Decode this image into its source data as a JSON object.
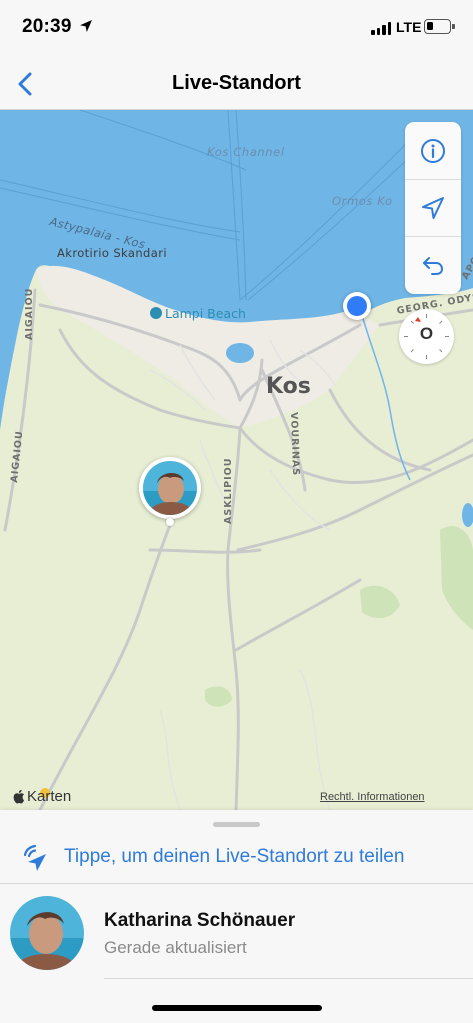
{
  "status_bar": {
    "time": "20:39",
    "network": "LTE",
    "location_icon": "location-arrow-icon",
    "battery_level_pct": 20
  },
  "nav": {
    "title": "Live-Standort",
    "back_icon": "chevron-left-icon"
  },
  "map": {
    "water_labels": [
      "Kos Channel",
      "Ormos Ko"
    ],
    "cape_labels": [
      "Astypalaia - Kos",
      "Akrotirio Skandari"
    ],
    "city_label": "Kos",
    "poi_label": "Lampi Beach",
    "road_labels": [
      "AIGAIOU",
      "AIGAIOU",
      "ASKLIPIOU",
      "VOURINAS",
      "GEORG. ODYSS",
      "APO"
    ],
    "attribution": "Karten",
    "legal": "Rechtl. Informationen",
    "compass_letter": "O",
    "controls": [
      "info-icon",
      "location-arrow-icon",
      "undo-icon"
    ],
    "colors": {
      "water": "#6fb5e6",
      "land": "#e9efd5",
      "urban": "#efede6",
      "user_location": "#2f7cf6"
    }
  },
  "sheet": {
    "share_text": "Tippe, um deinen Live-Standort zu teilen",
    "share_icon": "broadcast-location-icon",
    "accent": "#2f7bd9",
    "friends": [
      {
        "name": "Katharina Schönauer",
        "status": "Gerade aktualisiert"
      }
    ]
  }
}
